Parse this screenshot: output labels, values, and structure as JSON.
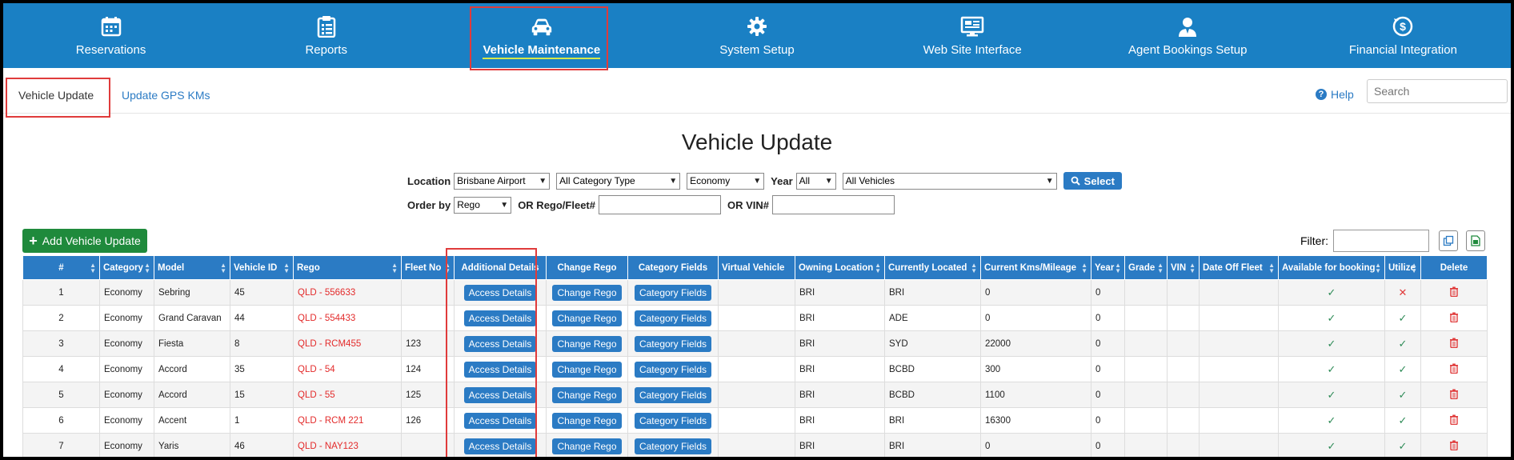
{
  "nav": {
    "items": [
      {
        "label": "Reservations",
        "icon": "calendar-icon"
      },
      {
        "label": "Reports",
        "icon": "clipboard-icon"
      },
      {
        "label": "Vehicle Maintenance",
        "icon": "car-icon",
        "active": true
      },
      {
        "label": "System Setup",
        "icon": "gear-icon"
      },
      {
        "label": "Web Site Interface",
        "icon": "monitor-icon"
      },
      {
        "label": "Agent Bookings Setup",
        "icon": "agent-icon"
      },
      {
        "label": "Financial Integration",
        "icon": "dollar-icon"
      }
    ]
  },
  "subnav": {
    "tabs": [
      "Vehicle Update",
      "Update GPS KMs"
    ],
    "help_label": "Help",
    "search_placeholder": "Search"
  },
  "page_title": "Vehicle Update",
  "form": {
    "location_label": "Location",
    "location_value": "Brisbane Airport",
    "category_type_value": "All Category Type",
    "category_value": "Economy",
    "year_label": "Year",
    "year_value": "All",
    "vehicles_value": "All Vehicles",
    "select_label": "Select",
    "order_by_label": "Order by",
    "order_by_value": "Rego",
    "rego_label": "OR Rego/Fleet#",
    "vin_label": "OR VIN#"
  },
  "add_button_label": "Add Vehicle Update",
  "filter_label": "Filter:",
  "table": {
    "headers": [
      "#",
      "Category",
      "Model",
      "Vehicle ID",
      "Rego",
      "Fleet No",
      "Additional Details",
      "Change Rego",
      "Category Fields",
      "Virtual Vehicle",
      "Owning Location",
      "Currently Located",
      "Current Kms/Mileage",
      "Year",
      "Grade",
      "VIN",
      "Date Off Fleet",
      "Available for booking",
      "Utilize",
      "Delete"
    ],
    "access_label": "Access Details",
    "change_rego_label": "Change Rego",
    "category_fields_label": "Category Fields",
    "rows": [
      {
        "num": "1",
        "category": "Economy",
        "model": "Sebring",
        "vehicle_id": "45",
        "rego": "QLD - 556633",
        "fleet_no": "",
        "owning": "BRI",
        "located": "BRI",
        "kms": "0",
        "year": "0",
        "available": true,
        "utilize": false
      },
      {
        "num": "2",
        "category": "Economy",
        "model": "Grand Caravan",
        "vehicle_id": "44",
        "rego": "QLD - 554433",
        "fleet_no": "",
        "owning": "BRI",
        "located": "ADE",
        "kms": "0",
        "year": "0",
        "available": true,
        "utilize": true
      },
      {
        "num": "3",
        "category": "Economy",
        "model": "Fiesta",
        "vehicle_id": "8",
        "rego": "QLD - RCM455",
        "fleet_no": "123",
        "owning": "BRI",
        "located": "SYD",
        "kms": "22000",
        "year": "0",
        "available": true,
        "utilize": true
      },
      {
        "num": "4",
        "category": "Economy",
        "model": "Accord",
        "vehicle_id": "35",
        "rego": "QLD - 54",
        "fleet_no": "124",
        "owning": "BRI",
        "located": "BCBD",
        "kms": "300",
        "year": "0",
        "available": true,
        "utilize": true
      },
      {
        "num": "5",
        "category": "Economy",
        "model": "Accord",
        "vehicle_id": "15",
        "rego": "QLD - 55",
        "fleet_no": "125",
        "owning": "BRI",
        "located": "BCBD",
        "kms": "1100",
        "year": "0",
        "available": true,
        "utilize": true
      },
      {
        "num": "6",
        "category": "Economy",
        "model": "Accent",
        "vehicle_id": "1",
        "rego": "QLD - RCM 221",
        "fleet_no": "126",
        "owning": "BRI",
        "located": "BRI",
        "kms": "16300",
        "year": "0",
        "available": true,
        "utilize": true
      },
      {
        "num": "7",
        "category": "Economy",
        "model": "Yaris",
        "vehicle_id": "46",
        "rego": "QLD - NAY123",
        "fleet_no": "",
        "owning": "BRI",
        "located": "BRI",
        "kms": "0",
        "year": "0",
        "available": true,
        "utilize": true
      }
    ]
  },
  "colors": {
    "nav_bg": "#1a80c4",
    "accent": "#2b7bc4",
    "add_green": "#1f8a3c",
    "highlight_red": "#e03b3b",
    "rego_red": "#e32b2b"
  }
}
